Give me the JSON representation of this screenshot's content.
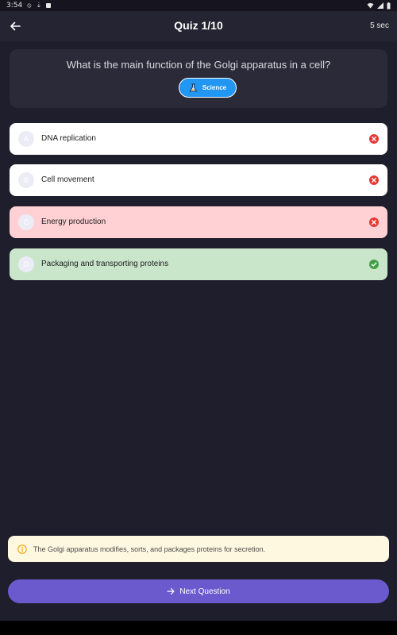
{
  "status_bar": {
    "time": "3:54",
    "left_icons": [
      "do-not-disturb-icon",
      "download-icon",
      "notification-icon"
    ],
    "right_icons": [
      "wifi-icon",
      "signal-icon",
      "battery-icon"
    ]
  },
  "app_bar": {
    "title": "Quiz 1/10",
    "timer": "5 sec",
    "back_icon": "arrow-left-icon"
  },
  "question": {
    "text": "What is the main function of the Golgi apparatus in a cell?",
    "category": "Science",
    "category_icon": "science-icon"
  },
  "options": [
    {
      "letter": "A",
      "text": "DNA replication",
      "state": "incorrect",
      "background": "#ffffff",
      "status_icon": "x-circle-icon"
    },
    {
      "letter": "B",
      "text": "Cell movement",
      "state": "incorrect",
      "background": "#ffffff",
      "status_icon": "x-circle-icon"
    },
    {
      "letter": "C",
      "text": "Energy production",
      "state": "selected-wrong",
      "background": "#ffd1d4",
      "status_icon": "x-circle-icon"
    },
    {
      "letter": "D",
      "text": "Packaging and transporting proteins",
      "state": "correct",
      "background": "#c9e6cb",
      "status_icon": "check-circle-icon"
    }
  ],
  "explanation": {
    "text": "The Golgi apparatus modifies, sorts, and packages proteins for secretion.",
    "icon": "info-icon"
  },
  "next_button": {
    "label": "Next Question",
    "icon": "arrow-right-icon"
  },
  "colors": {
    "background": "#1f1e2c",
    "accent": "#6a5acd",
    "chip": "#2196f3",
    "wrong_icon": "#e53935",
    "correct_icon": "#43a047",
    "warning": "#f59e0b"
  }
}
